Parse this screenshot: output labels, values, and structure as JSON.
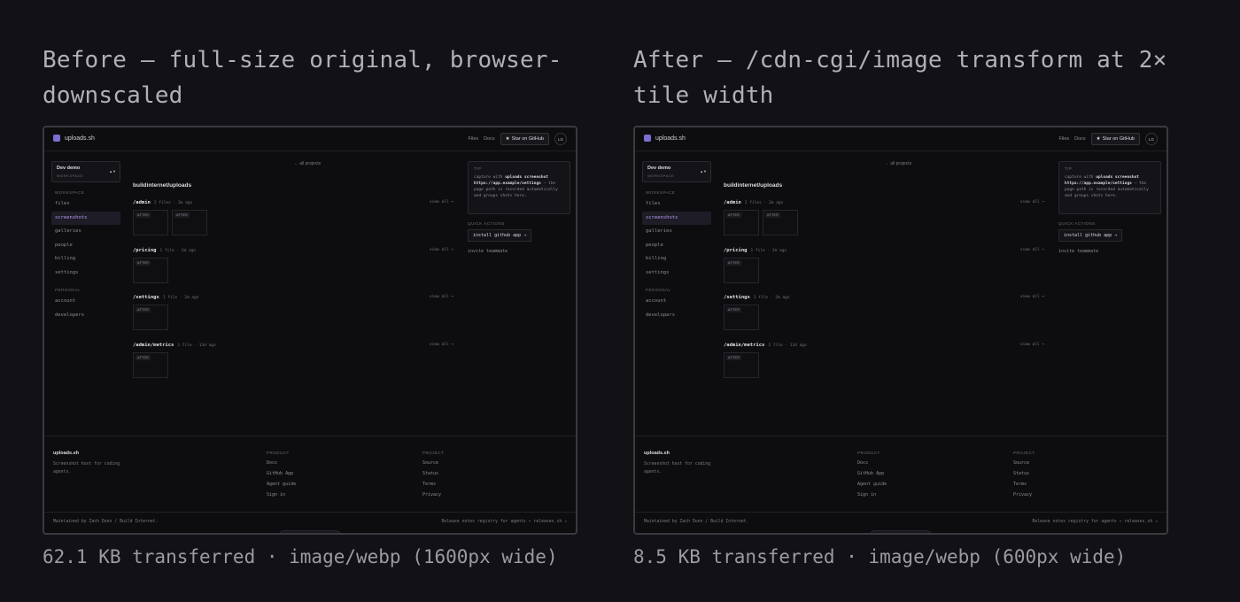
{
  "before": {
    "heading": "Before — full-size original, browser-downscaled",
    "caption": "62.1 KB transferred · image/webp (1600px wide)"
  },
  "after": {
    "heading": "After — /cdn-cgi/image transform at 2× tile width",
    "caption": "8.5 KB transferred · image/webp (600px wide)"
  },
  "app": {
    "logo": "uploads.sh",
    "nav": {
      "files": "Files",
      "docs": "Docs",
      "star": "Star on GitHub",
      "avatar": "LG"
    },
    "workspace": {
      "name": "Dev demo",
      "label": "WORKSPACE"
    },
    "sections": {
      "workspace": "WORKSPACE",
      "personal": "PERSONAL",
      "workspace_items": [
        "files",
        "screenshots",
        "galleries",
        "people",
        "billing",
        "settings"
      ],
      "personal_items": [
        "account",
        "developers"
      ],
      "active": "screenshots"
    },
    "main": {
      "all_projects": "← all projects",
      "repo": "buildinternet/uploads",
      "view_all": "view all →",
      "tag": "AFTER",
      "groups": [
        {
          "path": "/admin",
          "meta": "2 files · 2m ago",
          "tiles": 2
        },
        {
          "path": "/pricing",
          "meta": "1 file · 2m ago",
          "tiles": 1
        },
        {
          "path": "/settings",
          "meta": "1 file · 2m ago",
          "tiles": 1
        },
        {
          "path": "/admin/metrics",
          "meta": "1 file · 13d ago",
          "tiles": 1
        }
      ]
    },
    "tip": {
      "title": "TIP",
      "pre": "capture with",
      "cmd": "uploads screenshot https://app.example/settings",
      "post": "— the page path is recorded automatically and groups shots here."
    },
    "quick_actions": {
      "title": "QUICK ACTIONS",
      "install": "install github app →",
      "invite": "invite teammate"
    },
    "footer": {
      "brand": "uploads.sh",
      "desc": "Screenshot host for coding agents.",
      "col1": {
        "title": "PRODUCT",
        "links": [
          "Docs",
          "GitHub App",
          "Agent guide",
          "Sign in"
        ]
      },
      "col2": {
        "title": "PROJECT",
        "links": [
          "Source",
          "Status",
          "Terms",
          "Privacy"
        ]
      },
      "maintained": "Maintained by Zach Dunn / Build Internet.",
      "release": "Release notes registry for agents → releases.sh ↗"
    }
  }
}
